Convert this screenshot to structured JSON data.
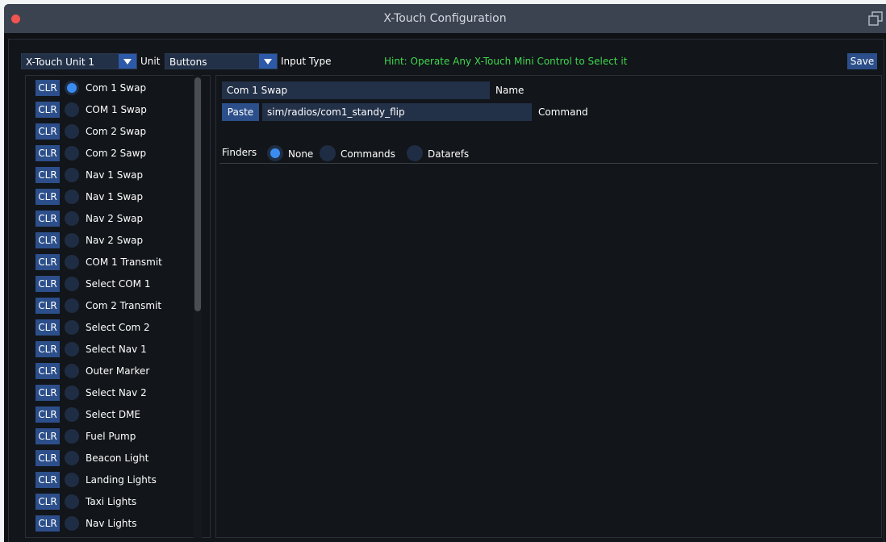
{
  "window": {
    "title": "X-Touch Configuration"
  },
  "toolbar": {
    "unit_select": "X-Touch Unit 1",
    "unit_label": "Unit",
    "input_type_select": "Buttons",
    "input_type_label": "Input Type",
    "hint": "Hint: Operate Any X-Touch Mini Control to Select it",
    "save_label": "Save"
  },
  "list": {
    "clear_label": "CLR",
    "items": [
      {
        "label": "Com 1 Swap",
        "selected": true
      },
      {
        "label": "COM 1 Swap",
        "selected": false
      },
      {
        "label": "Com 2 Swap",
        "selected": false
      },
      {
        "label": "Com 2 Sawp",
        "selected": false
      },
      {
        "label": "Nav 1 Swap",
        "selected": false
      },
      {
        "label": "Nav 1 Swap",
        "selected": false
      },
      {
        "label": "Nav 2 Swap",
        "selected": false
      },
      {
        "label": "Nav 2 Swap",
        "selected": false
      },
      {
        "label": "COM 1 Transmit",
        "selected": false
      },
      {
        "label": "Select COM 1",
        "selected": false
      },
      {
        "label": "Com 2 Transmit",
        "selected": false
      },
      {
        "label": "Select Com 2",
        "selected": false
      },
      {
        "label": "Select Nav 1",
        "selected": false
      },
      {
        "label": "Outer Marker",
        "selected": false
      },
      {
        "label": "Select Nav 2",
        "selected": false
      },
      {
        "label": "Select DME",
        "selected": false
      },
      {
        "label": "Fuel Pump",
        "selected": false
      },
      {
        "label": "Beacon Light",
        "selected": false
      },
      {
        "label": "Landing Lights",
        "selected": false
      },
      {
        "label": "Taxi Lights",
        "selected": false
      },
      {
        "label": "Nav Lights",
        "selected": false
      }
    ]
  },
  "detail": {
    "name_value": "Com 1 Swap",
    "name_label": "Name",
    "paste_label": "Paste",
    "command_value": "sim/radios/com1_standy_flip",
    "command_label": "Command",
    "finders_label": "Finders",
    "finders_options": [
      {
        "label": "None",
        "selected": true
      },
      {
        "label": "Commands",
        "selected": false
      },
      {
        "label": "Datarefs",
        "selected": false
      }
    ]
  },
  "colors": {
    "accent": "#3b8cf0",
    "button": "#2c4f8b",
    "hint": "#3fd84f",
    "close": "#f2544f"
  }
}
